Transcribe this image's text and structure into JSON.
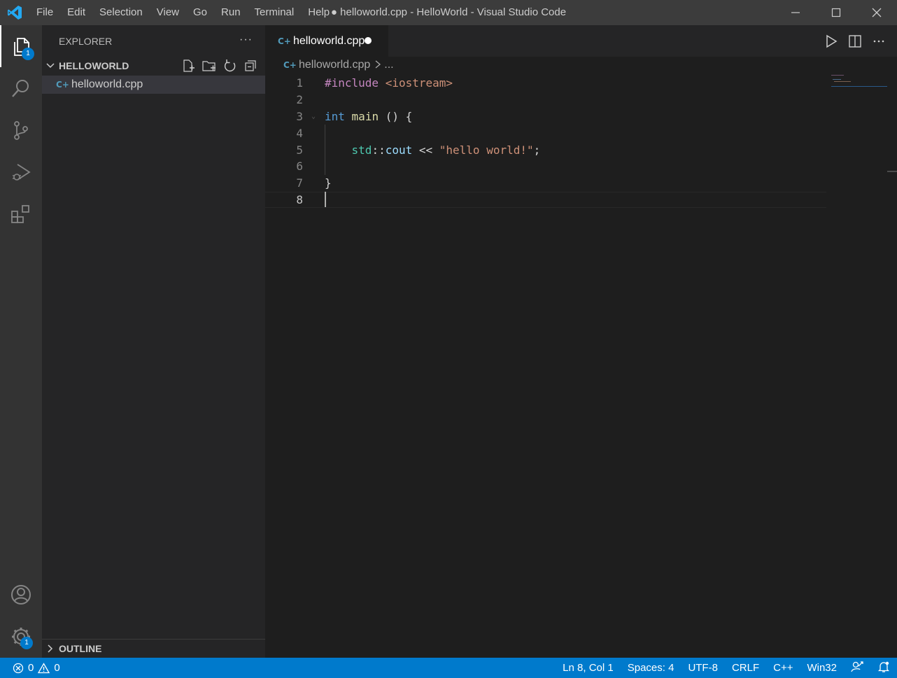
{
  "menu": [
    "File",
    "Edit",
    "Selection",
    "View",
    "Go",
    "Run",
    "Terminal",
    "Help"
  ],
  "window_title": "● helloworld.cpp - HelloWorld - Visual Studio Code",
  "activity_badges": {
    "explorer": "1",
    "manage": "1"
  },
  "sidebar": {
    "header": "EXPLORER",
    "more": "···",
    "folder": "HELLOWORLD",
    "files": [
      {
        "name": "helloworld.cpp"
      }
    ],
    "outline": "OUTLINE"
  },
  "file_icon_glyph": "C+",
  "editor": {
    "tab_label": "helloworld.cpp",
    "breadcrumb_file": "helloworld.cpp",
    "breadcrumb_rest": "...",
    "lines": [
      {
        "n": "1"
      },
      {
        "n": "2"
      },
      {
        "n": "3"
      },
      {
        "n": "4"
      },
      {
        "n": "5"
      },
      {
        "n": "6"
      },
      {
        "n": "7"
      },
      {
        "n": "8"
      }
    ]
  },
  "status": {
    "errors": "0",
    "warnings": "0",
    "position": "Ln 8, Col 1",
    "spaces": "Spaces: 4",
    "encoding": "UTF-8",
    "eol": "CRLF",
    "language": "C++",
    "platform": "Win32"
  },
  "colors": {
    "accent": "#007acc",
    "titlebar": "#3c3c3c",
    "activitybar": "#333333",
    "sidebar": "#252526",
    "editor": "#1e1e1e"
  }
}
